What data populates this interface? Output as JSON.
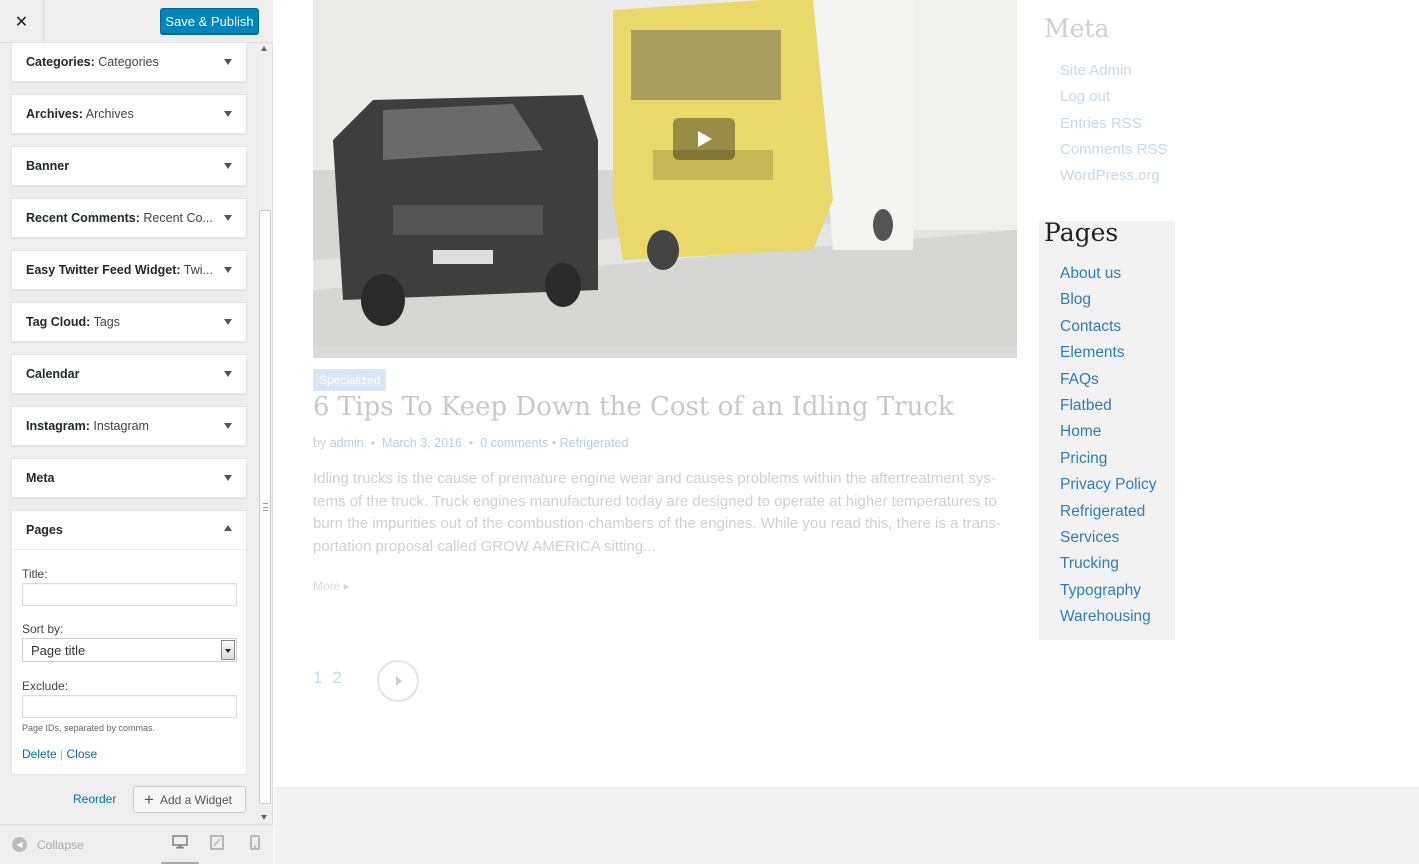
{
  "customizer": {
    "close_label": "✕",
    "publish_label": "Save & Publish",
    "widgets": [
      {
        "name": "Categories:",
        "title": "Categories"
      },
      {
        "name": "Archives:",
        "title": "Archives"
      },
      {
        "name": "Banner",
        "title": ""
      },
      {
        "name": "Recent Comments:",
        "title": "Recent Co..."
      },
      {
        "name": "Easy Twitter Feed Widget:",
        "title": "Twi..."
      },
      {
        "name": "Tag Cloud:",
        "title": "Tags"
      },
      {
        "name": "Calendar",
        "title": ""
      },
      {
        "name": "Instagram:",
        "title": "Instagram"
      },
      {
        "name": "Meta",
        "title": ""
      }
    ],
    "pages_widget": {
      "name": "Pages",
      "title_label": "Title:",
      "title_value": "",
      "sort_label": "Sort by:",
      "sort_value": "Page title",
      "exclude_label": "Exclude:",
      "exclude_value": "",
      "exclude_help": "Page IDs, separated by commas.",
      "delete_label": "Delete",
      "separator": "|",
      "close_label": "Close"
    },
    "reorder_label": "Reorder",
    "add_widget_label": "Add a Widget",
    "collapse_label": "Collapse"
  },
  "preview": {
    "post": {
      "category_badge": "Specialized",
      "title": "6 Tips To Keep Down the Cost of an Idling Truck",
      "meta_by": "by",
      "meta_author": "admin",
      "meta_dot": "•",
      "meta_date": "March 3, 2016",
      "meta_comments": "0 comments",
      "meta_category": "• Refrigerated",
      "excerpt": "Idling trucks is the cause of premature engine wear and causes problems within the aftertreatment sys-tems of the truck. Truck engines manufactured today are designed to operate at higher temperatures to burn the impurities out of the combustion chambers of the engines. While you read this, there is a trans-portation proposal called GROW AMERICA sitting...",
      "more_label": "More ▸"
    },
    "pagination": [
      "1",
      "2"
    ],
    "meta_widget": {
      "title": "Meta",
      "links": [
        "Site Admin",
        "Log out",
        "Entries RSS",
        "Comments RSS",
        "WordPress.org"
      ]
    },
    "pages_widget": {
      "title": "Pages",
      "links": [
        "About us",
        "Blog",
        "Contacts",
        "Elements",
        "FAQs",
        "Flatbed",
        "Home",
        "Pricing",
        "Privacy Policy",
        "Refrigerated",
        "Services",
        "Trucking",
        "Typography",
        "Warehousing"
      ]
    }
  }
}
